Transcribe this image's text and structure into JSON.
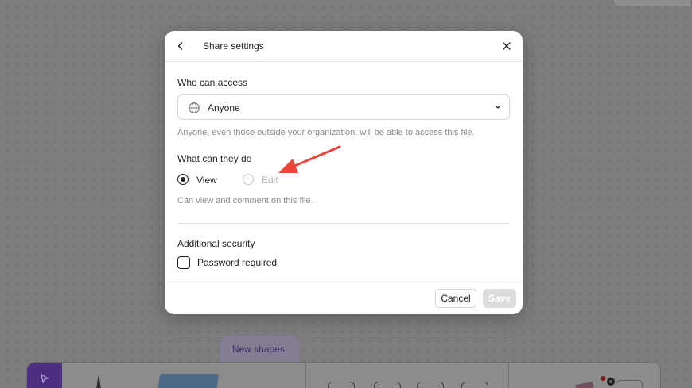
{
  "dialog": {
    "title": "Share settings",
    "access": {
      "label": "Who can access",
      "selected": "Anyone",
      "help": "Anyone, even those outside your organization, will be able to access this file."
    },
    "permissions": {
      "label": "What can they do",
      "options": [
        {
          "label": "View",
          "checked": true,
          "disabled": false
        },
        {
          "label": "Edit",
          "checked": false,
          "disabled": true
        }
      ],
      "help": "Can view and comment on this file."
    },
    "security": {
      "label": "Additional security",
      "password_label": "Password required",
      "password_checked": false
    },
    "buttons": {
      "cancel": "Cancel",
      "save": "Save"
    }
  },
  "background": {
    "new_shapes_badge": "New shapes!"
  },
  "colors": {
    "annotation_arrow": "#f0443a",
    "toolbar_accent": "#4c2f7f"
  },
  "icons": [
    "back-arrow-icon",
    "close-icon",
    "globe-icon",
    "chevron-down-icon",
    "cursor-icon"
  ]
}
